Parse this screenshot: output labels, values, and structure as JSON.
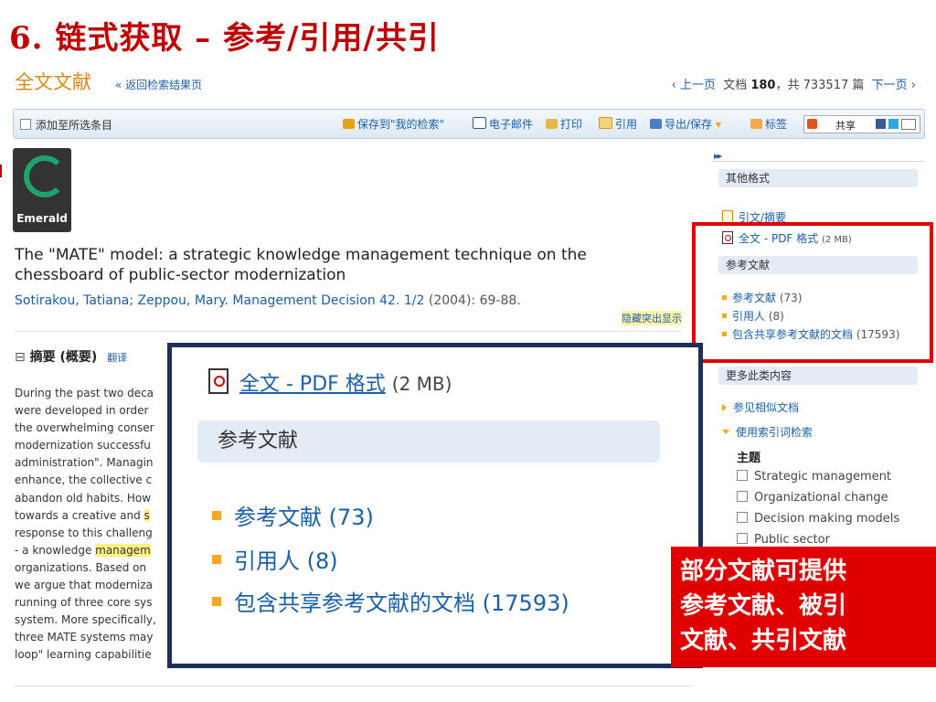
{
  "slide": {
    "title": "6.  链式获取  –  参考/引用/共引"
  },
  "header": {
    "doc_heading": "全文文献",
    "back_link": "« 返回检索结果页",
    "prev": "‹ 上一页",
    "doc_label": "文档",
    "doc_num": "180",
    "total_text": "，共 733517 篇",
    "next": "下一页 ›"
  },
  "toolbar": {
    "add_selected": "添加至所选条目",
    "save_search": "保存到\"我的检索\"",
    "email": "电子邮件",
    "print": "打印",
    "cite": "引用",
    "export": "导出/保存",
    "tag": "标签",
    "share": "共享"
  },
  "logo": {
    "name": "Emerald"
  },
  "article": {
    "title": "The \"MATE\" model: a strategic knowledge management technique on the chessboard of public-sector modernization",
    "authors": "Sotirakou, Tatiana; Zeppou, Mary. Management Decision 42. 1/2",
    "meta": " (2004): 69-88.",
    "hide_highlight": "隐藏突出显示"
  },
  "abstract": {
    "heading": "摘要 (概要)",
    "translate": "翻译",
    "lines": [
      "During the past two deca",
      "were developed in order",
      "the overwhelming conser",
      "modernization successfu",
      "administration\". Managin",
      "enhance, the collective c",
      "abandon old habits. How",
      "towards a creative and s",
      "response to this challeng",
      "- a knowledge managem",
      "organizations. Based on",
      "we argue that moderniza",
      "running of three core sys",
      "system. More specifically,",
      "three MATE systems may",
      "loop\" learning capabilitie"
    ]
  },
  "sidebar": {
    "arrows": "▸▸",
    "other_formats": "其他格式",
    "citation_abstract": "引文/摘要",
    "fulltext_pdf": "全文 - PDF 格式",
    "pdf_size": "(2 MB)",
    "references_head": "参考文献",
    "ref_link": "参考文献",
    "ref_count": "(73)",
    "cited_by": "引用人",
    "cited_count": "(8)",
    "shared_refs": "包含共享参考文献的文档",
    "shared_count": "(17593)",
    "more_like": "更多此类内容",
    "similar_docs": "参见相似文档",
    "index_search": "使用索引词检索",
    "subject_head": "主题",
    "subjects": [
      "Strategic management",
      "Organizational change",
      "Decision making models",
      "Public sector"
    ]
  },
  "zoom": {
    "fulltext_pdf": "全文 - PDF 格式",
    "pdf_size": "(2 MB)",
    "references_head": "参考文献",
    "ref_link": "参考文献",
    "ref_count": "(73)",
    "cited_by": "引用人",
    "cited_count": "(8)",
    "shared_refs": "包含共享参考文献的文档",
    "shared_count": "(17593)"
  },
  "annotation": {
    "line1": "部分文献可提供",
    "line2": "参考文献、被引",
    "line3": "文献、共引文献"
  },
  "colors": {
    "title_red": "#c00000",
    "link_blue": "#1a5fa8",
    "accent_orange": "#f5a623",
    "frame_red": "#e00000",
    "zoom_border": "#1e2e5c"
  }
}
